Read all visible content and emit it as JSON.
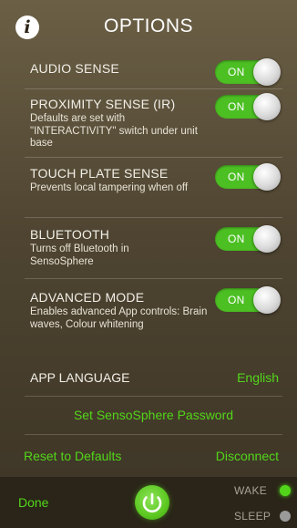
{
  "header": {
    "title": "OPTIONS",
    "info_icon": "info-icon"
  },
  "settings": [
    {
      "title": "AUDIO SENSE",
      "description": "",
      "toggle": "ON"
    },
    {
      "title": "PROXIMITY SENSE (IR)",
      "description": "Defaults are set with \"INTERACTIVITY\" switch under unit base",
      "toggle": "ON"
    },
    {
      "title": "TOUCH PLATE SENSE",
      "description": "Prevents local tampering when off",
      "toggle": "ON"
    },
    {
      "title": "BLUETOOTH",
      "description": "Turns off Bluetooth in SensoSphere",
      "toggle": "ON"
    },
    {
      "title": "ADVANCED MODE",
      "description": "Enables advanced App controls: Brain waves, Colour whitening",
      "toggle": "ON"
    }
  ],
  "language": {
    "label": "APP LANGUAGE",
    "value": "English"
  },
  "password": {
    "label": "Set SensoSphere Password"
  },
  "actions": {
    "reset": "Reset to Defaults",
    "disconnect": "Disconnect"
  },
  "bottom": {
    "done": "Done",
    "power_icon": "power-icon",
    "wake": "WAKE",
    "sleep": "SLEEP"
  },
  "colors": {
    "accent_green": "#52d61a",
    "toggle_on": "#4cbf23",
    "wake_dot": "#52d61a",
    "sleep_dot": "#9a9a9a"
  }
}
